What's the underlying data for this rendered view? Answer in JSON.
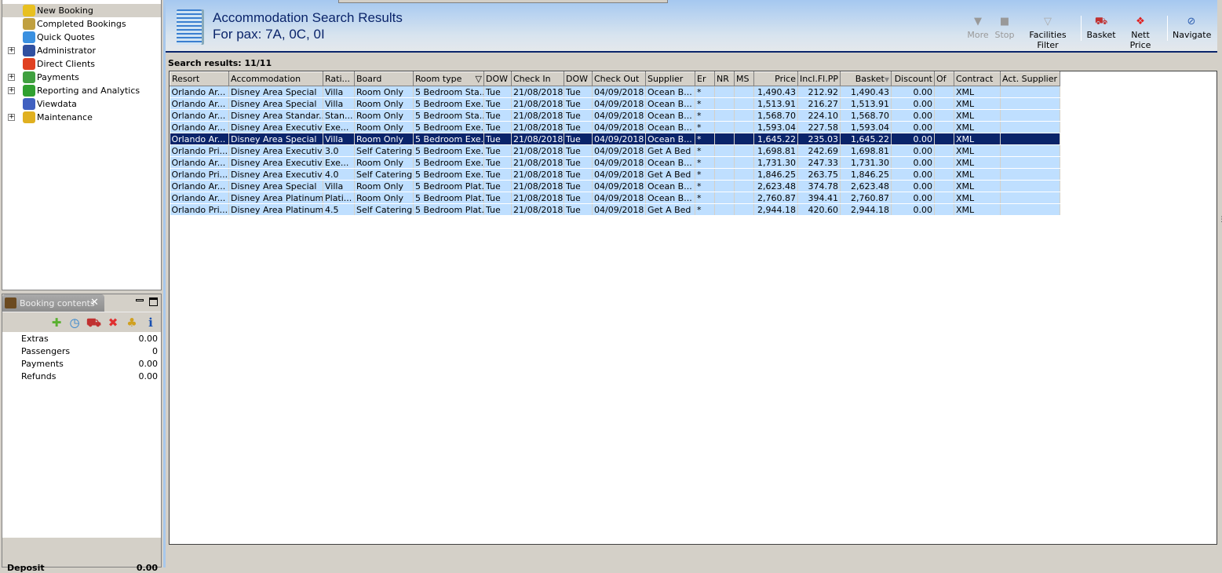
{
  "nav": {
    "items": [
      {
        "label": "New Booking",
        "expandable": false,
        "selected": true,
        "icon": "palm-island-icon",
        "color": "#e8c020"
      },
      {
        "label": "Completed Bookings",
        "expandable": false,
        "icon": "palm-money-icon",
        "color": "#c0a040"
      },
      {
        "label": "Quick Quotes",
        "expandable": false,
        "icon": "clock-icon",
        "color": "#3a90e0"
      },
      {
        "label": "Administrator",
        "expandable": true,
        "icon": "runner-icon",
        "color": "#3050a0"
      },
      {
        "label": "Direct Clients",
        "expandable": false,
        "icon": "gift-person-icon",
        "color": "#e04020"
      },
      {
        "label": "Payments",
        "expandable": true,
        "icon": "dollar-card-icon",
        "color": "#40a040"
      },
      {
        "label": "Reporting and Analytics",
        "expandable": true,
        "icon": "report-icon",
        "color": "#30a030"
      },
      {
        "label": "Viewdata",
        "expandable": false,
        "icon": "globe-icon",
        "color": "#4060c0"
      },
      {
        "label": "Maintenance",
        "expandable": true,
        "icon": "toolbox-icon",
        "color": "#e0b020"
      }
    ]
  },
  "booking_contents": {
    "title": "Booking contents",
    "rows": [
      {
        "label": "Extras",
        "value": "0.00"
      },
      {
        "label": "Passengers",
        "value": "0"
      },
      {
        "label": "Payments",
        "value": "0.00"
      },
      {
        "label": "Refunds",
        "value": "0.00"
      }
    ],
    "deposit_label": "Deposit",
    "deposit_value": "0.00"
  },
  "header": {
    "title": "Accommodation Search Results",
    "subtitle": "For pax: 7A, 0C, 0I"
  },
  "toolbar": {
    "more": "More",
    "stop": "Stop",
    "facilities_filter": "Facilities Filter",
    "basket": "Basket",
    "nett_price": "Nett Price",
    "navigate": "Navigate"
  },
  "results": {
    "count_label": "Search results: 11/11",
    "columns": [
      "Resort",
      "Accommodation",
      "Rati...",
      "Board",
      "Room type",
      "DOW",
      "Check In",
      "DOW",
      "Check Out",
      "Supplier",
      "Er",
      "NR",
      "MS",
      "Price",
      "Incl.Fl.PP",
      "Basket",
      "Discount",
      "Of",
      "Contract",
      "Act. Supplier"
    ],
    "selected_row": 4,
    "rows": [
      [
        "Orlando Ar...",
        "Disney Area Special",
        "Villa",
        "Room Only",
        "5 Bedroom Sta...",
        "Tue",
        "21/08/2018",
        "Tue",
        "04/09/2018",
        "Ocean B...",
        "*",
        "",
        "",
        "1,490.43",
        "212.92",
        "1,490.43",
        "0.00",
        "",
        "XML",
        ""
      ],
      [
        "Orlando Ar...",
        "Disney Area Special",
        "Villa",
        "Room Only",
        "5 Bedroom Exe...",
        "Tue",
        "21/08/2018",
        "Tue",
        "04/09/2018",
        "Ocean B...",
        "*",
        "",
        "",
        "1,513.91",
        "216.27",
        "1,513.91",
        "0.00",
        "",
        "XML",
        ""
      ],
      [
        "Orlando Ar...",
        "Disney Area Standar...",
        "Stan...",
        "Room Only",
        "5 Bedroom Sta...",
        "Tue",
        "21/08/2018",
        "Tue",
        "04/09/2018",
        "Ocean B...",
        "*",
        "",
        "",
        "1,568.70",
        "224.10",
        "1,568.70",
        "0.00",
        "",
        "XML",
        ""
      ],
      [
        "Orlando Ar...",
        "Disney Area Executiv...",
        "Exe...",
        "Room Only",
        "5 Bedroom Exe...",
        "Tue",
        "21/08/2018",
        "Tue",
        "04/09/2018",
        "Ocean B...",
        "*",
        "",
        "",
        "1,593.04",
        "227.58",
        "1,593.04",
        "0.00",
        "",
        "XML",
        ""
      ],
      [
        "Orlando Ar...",
        "Disney Area Special",
        "Villa",
        "Room Only",
        "5 Bedroom Exe...",
        "Tue",
        "21/08/2018",
        "Tue",
        "04/09/2018",
        "Ocean B...",
        "*",
        "",
        "",
        "1,645.22",
        "235.03",
        "1,645.22",
        "0.00",
        "",
        "XML",
        ""
      ],
      [
        "Orlando Pri...",
        "Disney Area Executiv...",
        "3.0",
        "Self Catering",
        "5 Bedroom Exe...",
        "Tue",
        "21/08/2018",
        "Tue",
        "04/09/2018",
        "Get A Bed",
        "*",
        "",
        "",
        "1,698.81",
        "242.69",
        "1,698.81",
        "0.00",
        "",
        "XML",
        ""
      ],
      [
        "Orlando Ar...",
        "Disney Area Executiv...",
        "Exe...",
        "Room Only",
        "5 Bedroom Exe...",
        "Tue",
        "21/08/2018",
        "Tue",
        "04/09/2018",
        "Ocean B...",
        "*",
        "",
        "",
        "1,731.30",
        "247.33",
        "1,731.30",
        "0.00",
        "",
        "XML",
        ""
      ],
      [
        "Orlando Pri...",
        "Disney Area Executiv...",
        "4.0",
        "Self Catering",
        "5 Bedroom Exe...",
        "Tue",
        "21/08/2018",
        "Tue",
        "04/09/2018",
        "Get A Bed",
        "*",
        "",
        "",
        "1,846.25",
        "263.75",
        "1,846.25",
        "0.00",
        "",
        "XML",
        ""
      ],
      [
        "Orlando Ar...",
        "Disney Area Special",
        "Villa",
        "Room Only",
        "5 Bedroom Plat...",
        "Tue",
        "21/08/2018",
        "Tue",
        "04/09/2018",
        "Ocean B...",
        "*",
        "",
        "",
        "2,623.48",
        "374.78",
        "2,623.48",
        "0.00",
        "",
        "XML",
        ""
      ],
      [
        "Orlando Ar...",
        "Disney Area Platinum...",
        "Plati...",
        "Room Only",
        "5 Bedroom Plat...",
        "Tue",
        "21/08/2018",
        "Tue",
        "04/09/2018",
        "Ocean B...",
        "*",
        "",
        "",
        "2,760.87",
        "394.41",
        "2,760.87",
        "0.00",
        "",
        "XML",
        ""
      ],
      [
        "Orlando Pri...",
        "Disney Area Platinum...",
        "4.5",
        "Self Catering",
        "5 Bedroom Plat...",
        "Tue",
        "21/08/2018",
        "Tue",
        "04/09/2018",
        "Get A Bed",
        "*",
        "",
        "",
        "2,944.18",
        "420.60",
        "2,944.18",
        "0.00",
        "",
        "XML",
        ""
      ]
    ]
  }
}
